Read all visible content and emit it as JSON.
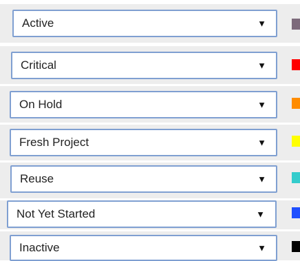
{
  "status_options": [
    {
      "label": "Active",
      "color": "#7d6a7b"
    },
    {
      "label": "Critical",
      "color": "#ff0000"
    },
    {
      "label": "On Hold",
      "color": "#ff8c00"
    },
    {
      "label": "Fresh Project",
      "color": "#ffff00"
    },
    {
      "label": "Reuse",
      "color": "#33cccc"
    },
    {
      "label": "Not Yet Started",
      "color": "#1f4fff"
    },
    {
      "label": "Inactive",
      "color": "#000000"
    }
  ],
  "dropdown_arrow_glyph": "▼"
}
